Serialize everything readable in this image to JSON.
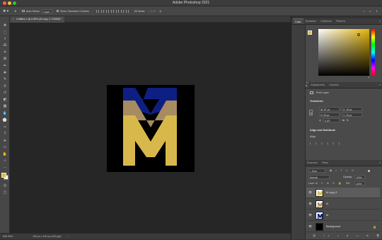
{
  "app": {
    "title": "Adobe Photoshop 2021"
  },
  "options": {
    "auto_select_label": "Auto-Select:",
    "auto_select_value": "Layer",
    "show_transform_label": "Show Transform Controls",
    "mode_3d": "3D Mode:"
  },
  "document": {
    "tab_label": "Untitled-1 @ 6.55% (M copy 2, RGB/8) *"
  },
  "status": {
    "zoom": "655.36%",
    "dimensions": "150 px x 150 px (300 ppi)"
  },
  "colors": {
    "foreground": "#e3b93c",
    "background": "#ffffff",
    "gold": "#d8b84a",
    "tan": "#a78b61",
    "navy": "#0e1f84"
  },
  "color_panel": {
    "tabs": [
      "Color",
      "Swatches",
      "Gradients",
      "Patterns"
    ]
  },
  "properties_panel": {
    "tabs": [
      "Properties",
      "Adjustments",
      "Libraries"
    ],
    "kind": "Pixel Layer",
    "transform_title": "Transform",
    "w": "W: 87 px",
    "h": "H: 93 px",
    "x": "X: 18 px",
    "y": "Y: 33 px",
    "angle": "0.00°",
    "align_title": "Align and Distribute",
    "align_label": "Align:"
  },
  "layers_panel": {
    "tabs": [
      "Layers",
      "Channels",
      "Paths"
    ],
    "kind_filter": "Kind",
    "blend_mode": "Normal",
    "opacity_label": "Opacity:",
    "opacity_value": "100%",
    "lock_label": "Lock:",
    "fill_label": "Fill:",
    "fill_value": "100%",
    "layers": [
      {
        "name": "M copy 2",
        "selected": true
      },
      {
        "name": "M",
        "selected": false
      },
      {
        "name": "M",
        "selected": false
      },
      {
        "name": "Background",
        "selected": false
      }
    ]
  }
}
